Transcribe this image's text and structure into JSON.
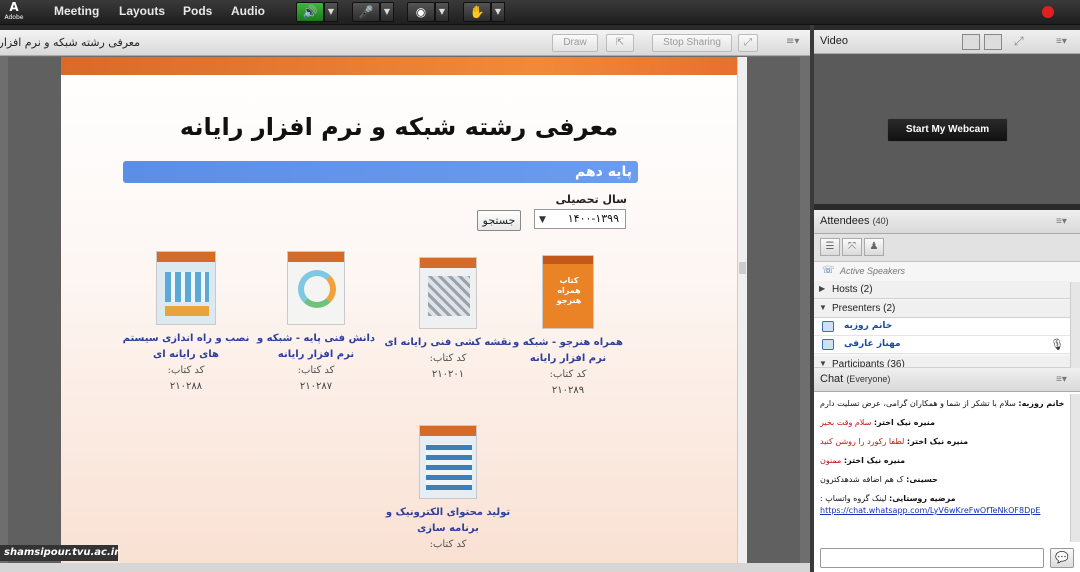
{
  "topbar": {
    "logo_text": "Adobe",
    "menus": [
      "Meeting",
      "Layouts",
      "Pods",
      "Audio"
    ]
  },
  "share_pod": {
    "doc_title": "معرفی رشته شبکه و نرم افزار رایانه.pdf",
    "draw_label": "Draw",
    "stop_sharing_label": "Stop Sharing",
    "page": {
      "main_title": "معرفی رشته شبکه و نرم افزار رایانه",
      "grade_banner": "پایه دهم",
      "year_label": "سال تحصیلی",
      "year_value": "۱۴۰۰-۱۳۹۹",
      "search_button": "جستجو",
      "books": [
        {
          "title": "همراه هنرجو - شبکه و نرم افزار رایانه",
          "code_label": "کد کتاب:",
          "code": "۲۱۰۲۸۹",
          "cover_text": "کتاب همراه هنرجو"
        },
        {
          "title": "نقشه کشی فنی رایانه ای",
          "code_label": "کد کتاب:",
          "code": "۲۱۰۲۰۱"
        },
        {
          "title": "دانش فنی پایه - شبکه و نرم افزار رایانه",
          "code_label": "کد کتاب:",
          "code": "۲۱۰۲۸۷"
        },
        {
          "title": "نصب و راه اندازی سیستم های رایانه ای",
          "code_label": "کد کتاب:",
          "code": "۲۱۰۲۸۸"
        },
        {
          "title": "تولید محتوای الکترونیک و برنامه سازی",
          "code_label": "کد کتاب:",
          "code": ""
        }
      ]
    },
    "watermark": "shamsipour.tvu.ac.ir"
  },
  "video_pod": {
    "title": "Video",
    "webcam_button": "Start My Webcam"
  },
  "attendees_pod": {
    "title": "Attendees",
    "count": "(40)",
    "active_speakers": "Active Speakers",
    "hosts": "Hosts (2)",
    "presenters": "Presenters (2)",
    "presenter_names": [
      "خانم روزبه",
      "مهناز عارفی"
    ],
    "participants": "Participants (36)"
  },
  "chat_pod": {
    "title": "Chat",
    "scope": "(Everyone)",
    "messages": [
      {
        "who": "خانم روزبه:",
        "text": "سلام با تشکر از شما و همکاران گرامی، عرض تسلیت دارم"
      },
      {
        "who": "منیره نیک اختر:",
        "text": "سلام وقت بخیر",
        "red": true
      },
      {
        "who": "منیره نیک اختر:",
        "text": "لطفا رکورد را روشن کنید",
        "red": true
      },
      {
        "who": "منیره نیک اختر:",
        "text": "ممنون",
        "red": true
      },
      {
        "who": "حسینی:",
        "text": "ک هم اضافه شدهدکترون"
      },
      {
        "who": "مرضیه روستایی:",
        "text": "لینک گروه واتساپ :",
        "link": "https://chat.whatsapp.com/LyV6wKreFwOfTeNkOF8DpE"
      }
    ]
  },
  "colors": {
    "accent_green": "#2f9f2f",
    "banner_blue": "#5b8ee6",
    "record_red": "#e02020"
  }
}
